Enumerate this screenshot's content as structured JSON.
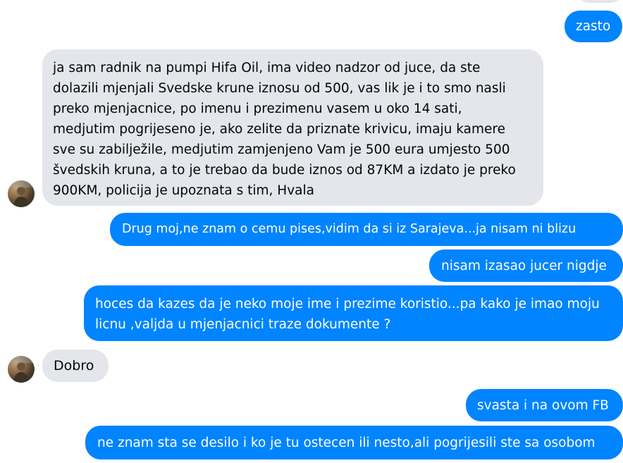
{
  "conversation": {
    "messages": [
      {
        "id": "m1",
        "direction": "outgoing",
        "text": "zasto"
      },
      {
        "id": "m2",
        "direction": "incoming",
        "text": "ja sam radnik na pumpi Hifa Oil, ima video nadzor od juce, da ste dolazili mjenjali Svedske krune iznosu od 500, vas lik je i to smo nasli preko mjenjacnice, po imenu i prezimenu vasem u oko 14 sati, medjutim pogrijeseno je, ako zelite da priznate krivicu, imaju kamere sve su zabilježile, medjutim zamjenjeno Vam je 500 eura umjesto 500 švedskih kruna, a to je trebao da bude iznos od 87KM a izdato je preko 900KM, policija je upoznata s tim, Hvala"
      },
      {
        "id": "m3",
        "direction": "outgoing",
        "text": "Drug moj,ne znam o cemu pises,vidim da si iz Sarajeva...ja nisam ni blizu"
      },
      {
        "id": "m4",
        "direction": "outgoing",
        "text": "nisam izasao jucer nigdje"
      },
      {
        "id": "m5",
        "direction": "outgoing",
        "text": "hoces da kazes da je neko moje ime i prezime koristio...pa kako je imao moju licnu ,valjda u mjenjacnici traze dokumente ?"
      },
      {
        "id": "m6",
        "direction": "incoming",
        "text": "Dobro"
      },
      {
        "id": "m7",
        "direction": "outgoing",
        "text": "svasta i na ovom FB"
      },
      {
        "id": "m8",
        "direction": "outgoing",
        "text": "ne znam sta se desilo i ko je tu ostecen ili nesto,ali pogrijesili ste sa osobom"
      }
    ]
  },
  "colors": {
    "outgoing_bubble": "#0084ff",
    "incoming_bubble": "#e4e6eb",
    "outgoing_text": "#ffffff",
    "incoming_text": "#050505"
  },
  "icons": {
    "sender_avatar": "avatar-icon"
  }
}
